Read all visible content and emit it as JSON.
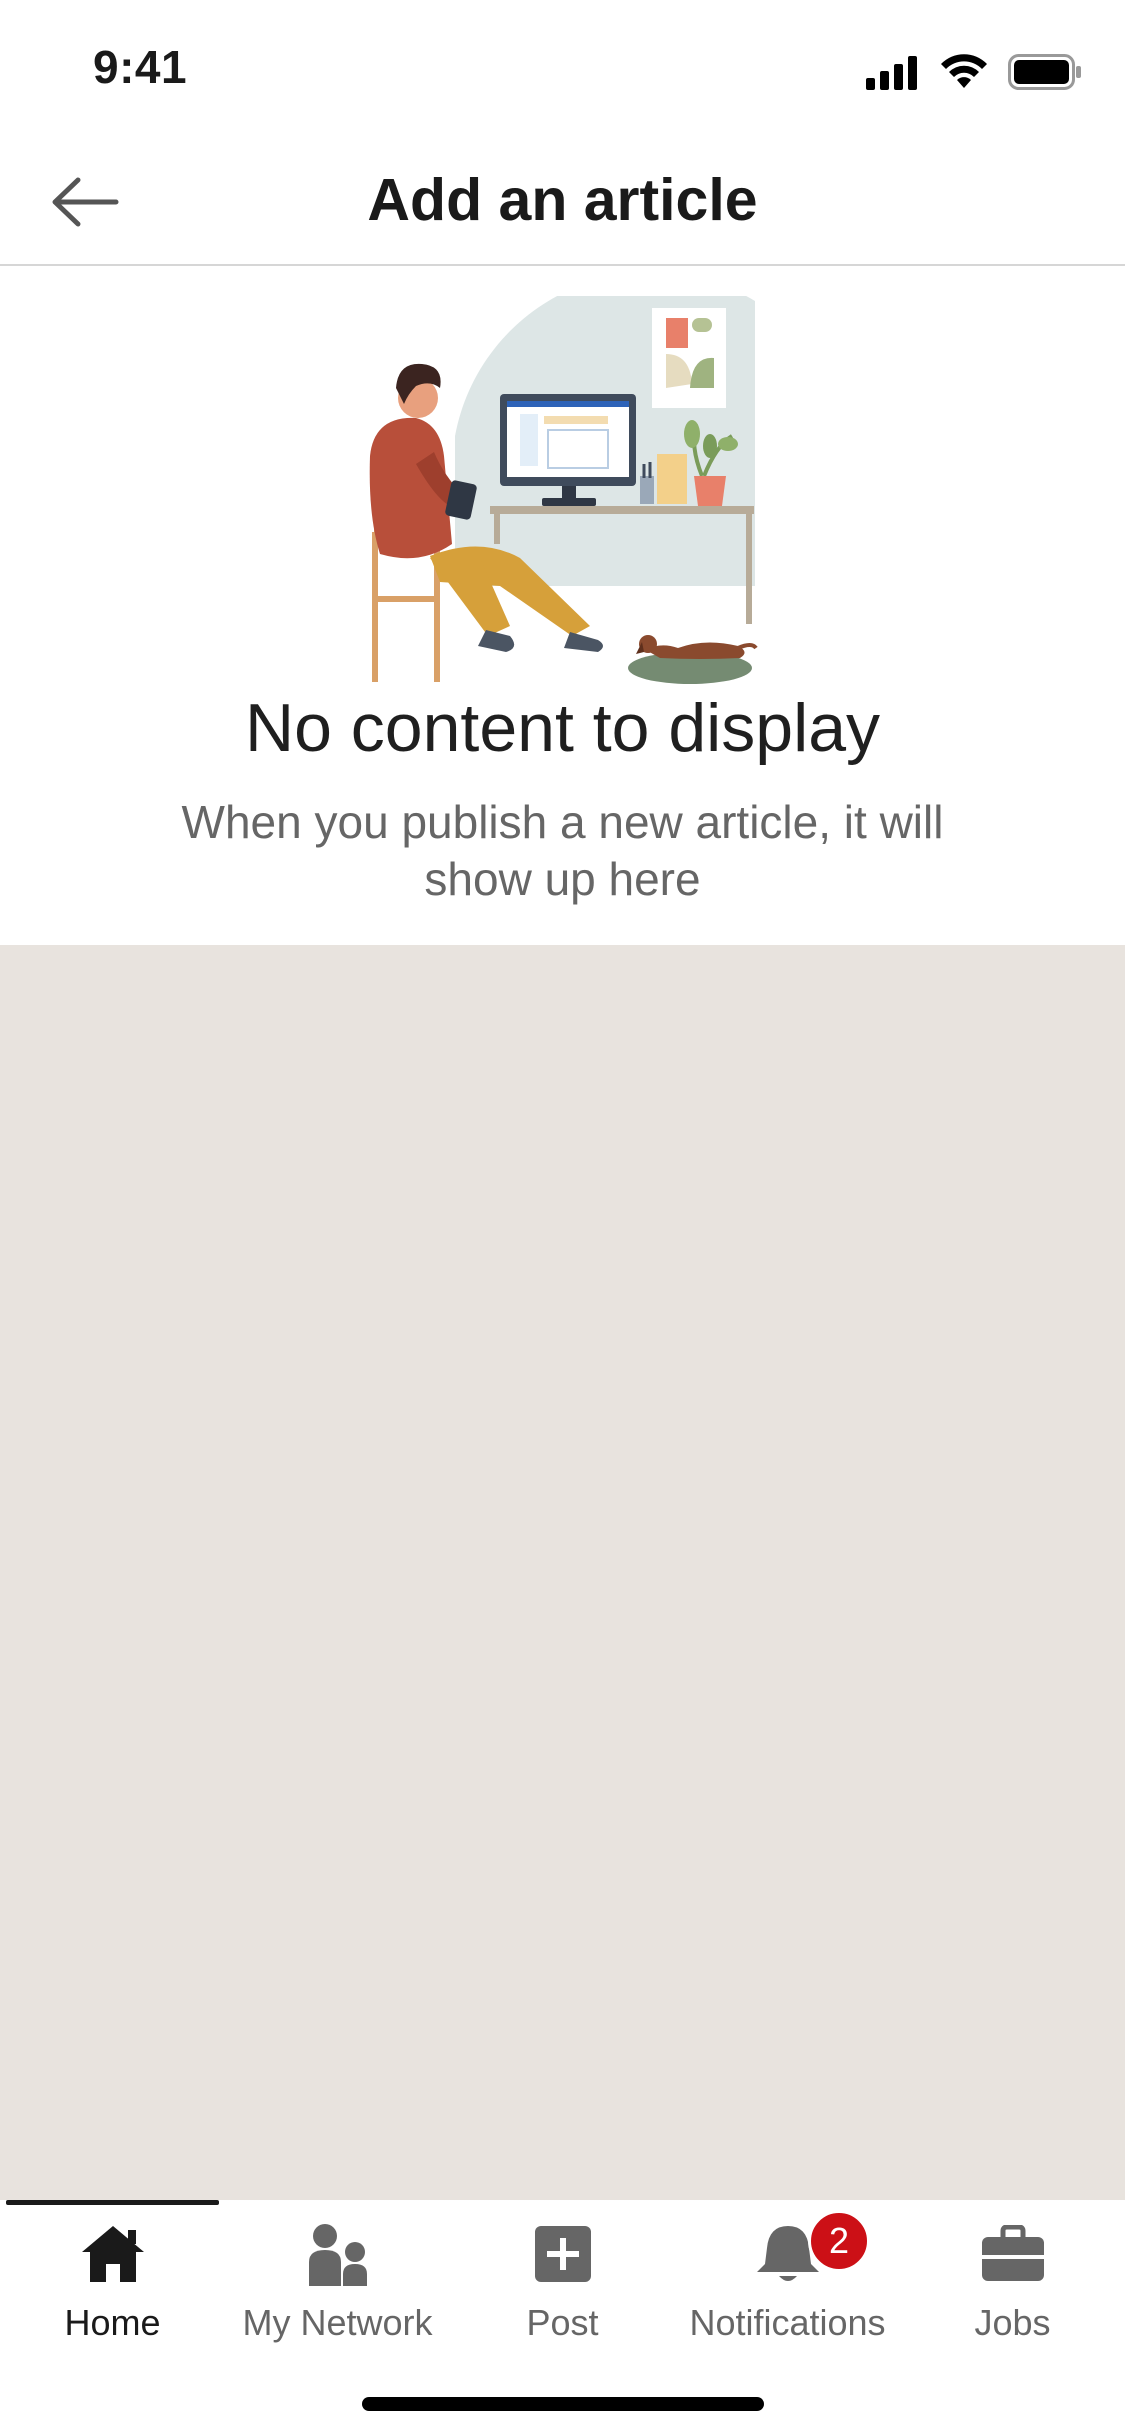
{
  "status_bar": {
    "time": "9:41"
  },
  "header": {
    "title": "Add an article",
    "back_icon": "arrow-left-icon"
  },
  "empty_state": {
    "title": "No content to display",
    "subtitle": "When you publish a new article, it will show up here"
  },
  "bottom_nav": {
    "items": [
      {
        "label": "Home",
        "icon": "home-icon",
        "active": true
      },
      {
        "label": "My Network",
        "icon": "network-icon",
        "active": false
      },
      {
        "label": "Post",
        "icon": "plus-square-icon",
        "active": false
      },
      {
        "label": "Notifications",
        "icon": "bell-icon",
        "active": false,
        "badge": "2"
      },
      {
        "label": "Jobs",
        "icon": "briefcase-icon",
        "active": false
      }
    ]
  },
  "colors": {
    "content_bg": "#e8e3de",
    "badge": "#cc1016",
    "text_primary": "#1a1a1a",
    "text_secondary": "#666666"
  }
}
